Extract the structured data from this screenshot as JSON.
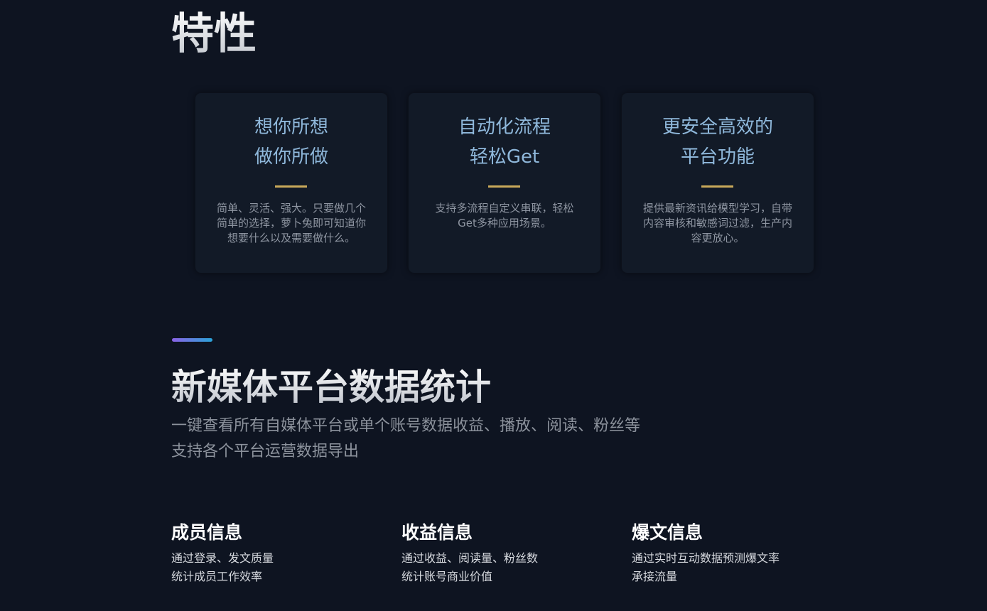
{
  "features": {
    "title": "特性",
    "cards": [
      {
        "title_lines": [
          "想你所想",
          "做你所做"
        ],
        "desc_lines": [
          "简单、灵活、强大。只要做几个",
          "简单的选择，萝卜兔即可知道你",
          "想要什么以及需要做什么。"
        ]
      },
      {
        "title_lines": [
          "自动化流程",
          "轻松Get"
        ],
        "desc_lines": [
          "支持多流程自定义串联，轻松",
          "Get多种应用场景。"
        ]
      },
      {
        "title_lines": [
          "更安全高效的",
          "平台功能"
        ],
        "desc_lines": [
          "提供最新资讯给模型学习，自带",
          "内容审核和敏感词过滤，生产内",
          "容更放心。"
        ]
      }
    ],
    "colors": {
      "background": "#0e1421",
      "card_bg": "#121a27",
      "card_title": "#8fb8db",
      "divider": "#c9a95a"
    }
  },
  "stats": {
    "title": "新媒体平台数据统计",
    "subtitle_lines": [
      "一键查看所有自媒体平台或单个账号数据收益、播放、阅读、粉丝等",
      "支持各个平台运营数据导出"
    ],
    "accent_gradient": [
      "#8b63e6",
      "#2aa3d8"
    ],
    "items": [
      {
        "title": "成员信息",
        "desc_lines": [
          "通过登录、发文质量",
          "统计成员工作效率"
        ]
      },
      {
        "title": "收益信息",
        "desc_lines": [
          "通过收益、阅读量、粉丝数",
          "统计账号商业价值"
        ]
      },
      {
        "title": "爆文信息",
        "desc_lines": [
          "通过实时互动数据预测爆文率",
          "承接流量"
        ]
      }
    ]
  }
}
